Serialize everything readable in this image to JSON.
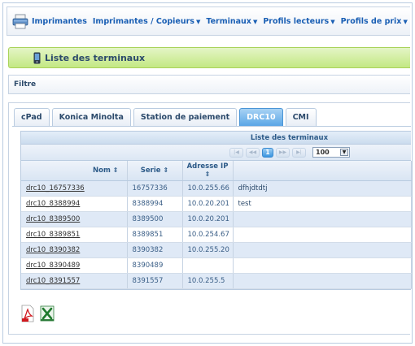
{
  "nav": {
    "items": [
      {
        "label": "Imprimantes",
        "dropdown": false
      },
      {
        "label": "Imprimantes / Copieurs",
        "dropdown": true
      },
      {
        "label": "Terminaux",
        "dropdown": true
      },
      {
        "label": "Profils lecteurs",
        "dropdown": true
      },
      {
        "label": "Profils de prix",
        "dropdown": true
      }
    ]
  },
  "header": {
    "title": "Liste des terminaux"
  },
  "filter": {
    "label": "Filtre"
  },
  "tabs": [
    {
      "label": "cPad",
      "active": false
    },
    {
      "label": "Konica Minolta",
      "active": false
    },
    {
      "label": "Station de paiement",
      "active": false
    },
    {
      "label": "DRC10",
      "active": true
    },
    {
      "label": "CMI",
      "active": false
    }
  ],
  "grid": {
    "caption": "Liste des terminaux",
    "pager": {
      "current_page": "1",
      "page_size": "100"
    },
    "columns": {
      "name": "Nom",
      "serie": "Serie",
      "ip": "Adresse IP",
      "desc": ""
    },
    "rows": [
      {
        "name": "drc10_16757336",
        "serie": "16757336",
        "ip": "10.0.255.66",
        "desc": "dfhjdtdtj"
      },
      {
        "name": "drc10_8388994",
        "serie": "8388994",
        "ip": "10.0.20.201",
        "desc": "test"
      },
      {
        "name": "drc10_8389500",
        "serie": "8389500",
        "ip": "10.0.20.201",
        "desc": ""
      },
      {
        "name": "drc10_8389851",
        "serie": "8389851",
        "ip": "10.0.254.67",
        "desc": ""
      },
      {
        "name": "drc10_8390382",
        "serie": "8390382",
        "ip": "10.0.255.20",
        "desc": ""
      },
      {
        "name": "drc10_8390489",
        "serie": "8390489",
        "ip": "",
        "desc": ""
      },
      {
        "name": "drc10_8391557",
        "serie": "8391557",
        "ip": "10.0.255.5",
        "desc": ""
      }
    ]
  },
  "export": {
    "pdf_icon": "pdf-export-icon",
    "excel_icon": "excel-export-icon"
  },
  "colors": {
    "accent": "#1a5fb4",
    "header_green": "#c3e883",
    "active_tab": "#5aa6e6",
    "alt_row": "#dfe9f6"
  }
}
